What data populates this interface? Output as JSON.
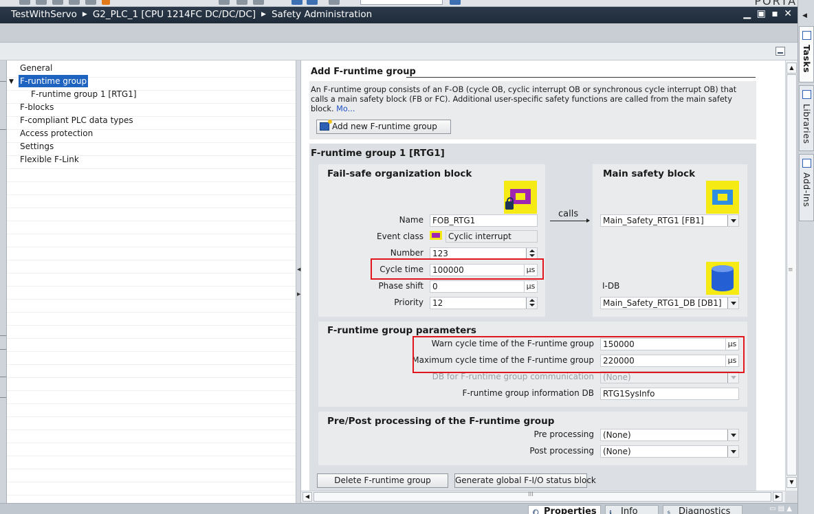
{
  "window": {
    "breadcrumb": [
      "TestWithServo",
      "G2_PLC_1 [CPU 1214FC DC/DC/DC]",
      "Safety Administration"
    ],
    "portal_label": "PORTAL",
    "controls": "▁ ▣ ▪ ✕"
  },
  "nav": {
    "items": [
      {
        "label": "General",
        "selected": false,
        "indent": 0
      },
      {
        "label": "F-runtime group",
        "selected": true,
        "indent": 0
      },
      {
        "label": "F-runtime group 1 [RTG1]",
        "selected": false,
        "indent": 1
      },
      {
        "label": "F-blocks",
        "selected": false,
        "indent": 0
      },
      {
        "label": "F-compliant PLC data types",
        "selected": false,
        "indent": 0
      },
      {
        "label": "Access protection",
        "selected": false,
        "indent": 0
      },
      {
        "label": "Settings",
        "selected": false,
        "indent": 0
      },
      {
        "label": "Flexible F-Link",
        "selected": false,
        "indent": 0
      }
    ],
    "toggle_icon": "▼"
  },
  "add_section": {
    "title": "Add F-runtime group",
    "description": "An F-runtime group consists of an F-OB (cycle OB, cyclic interrupt OB or synchronous cycle interrupt OB) that calls a main safety block (FB or FC). Additional user-specific safety functions are called from the main safety block.",
    "more_link": "Mo...",
    "add_button": "Add new F-runtime group"
  },
  "group": {
    "title": "F-runtime group 1 [RTG1]",
    "fob": {
      "title": "Fail-safe organization block",
      "name_label": "Name",
      "name_value": "FOB_RTG1",
      "event_label": "Event class",
      "event_value": "Cyclic interrupt",
      "number_label": "Number",
      "number_value": "123",
      "cycle_label": "Cycle time",
      "cycle_value": "100000",
      "phase_label": "Phase shift",
      "phase_value": "0",
      "priority_label": "Priority",
      "priority_value": "12",
      "unit": "µs"
    },
    "calls_label": "calls",
    "main": {
      "title": "Main safety block",
      "block_value": "Main_Safety_RTG1 [FB1]",
      "idb_label": "I-DB",
      "idb_value": "Main_Safety_RTG1_DB [DB1]"
    },
    "params": {
      "title": "F-runtime group parameters",
      "warn_label": "Warn cycle time of the F-runtime group",
      "warn_value": "150000",
      "max_label": "Maximum cycle time of the F-runtime group",
      "max_value": "220000",
      "comm_label": "DB for F-runtime group communication",
      "comm_value": "(None)",
      "info_label": "F-runtime group information DB",
      "info_value": "RTG1SysInfo",
      "unit": "µs"
    },
    "prepost": {
      "title": "Pre/Post processing of the F-runtime group",
      "pre_label": "Pre processing",
      "pre_value": "(None)",
      "post_label": "Post processing",
      "post_value": "(None)"
    },
    "delete_button": "Delete F-runtime group",
    "generate_button": "Generate global F-I/O status block"
  },
  "bottom_tabs": [
    {
      "label": "Properties",
      "icon": "magnifier-icon",
      "active": true
    },
    {
      "label": "Info",
      "icon": "info-icon",
      "active": false
    },
    {
      "label": "Diagnostics",
      "icon": "diagnostics-icon",
      "active": false
    }
  ],
  "task_tabs": [
    {
      "label": "Tasks",
      "active": true
    },
    {
      "label": "Libraries",
      "active": false
    },
    {
      "label": "Add-Ins",
      "active": false
    }
  ],
  "colors": {
    "title_bar": "#1f2b39",
    "selection": "#1f63c0",
    "highlight": "#e2151b",
    "icon_yellow": "#f5ea13",
    "ob_purple": "#9e26b2",
    "fb_blue": "#2f8ee0"
  }
}
